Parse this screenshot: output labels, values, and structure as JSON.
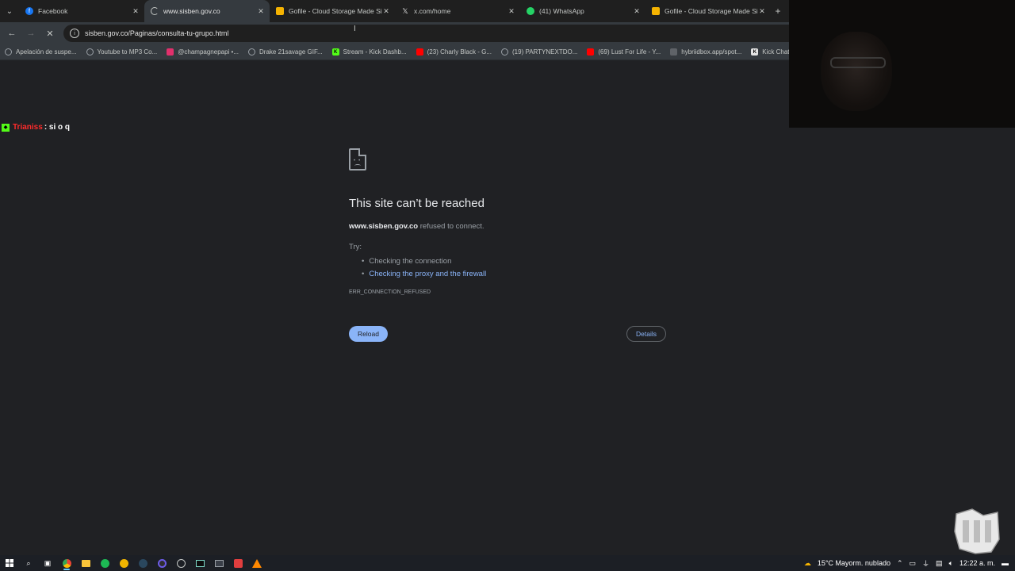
{
  "tabs": [
    {
      "title": "Facebook",
      "icon": "facebook-icon",
      "color": "#1877f2",
      "active": false
    },
    {
      "title": "www.sisben.gov.co",
      "icon": "loading-spinner-icon",
      "color": "#c4c7c5",
      "active": true
    },
    {
      "title": "Gofile - Cloud Storage Made Si",
      "icon": "gofile-icon",
      "color": "#f5b301",
      "active": false
    },
    {
      "title": "x.com/home",
      "icon": "x-icon",
      "color": "#e3e3e3",
      "active": false
    },
    {
      "title": "(41) WhatsApp",
      "icon": "whatsapp-icon",
      "color": "#25d366",
      "active": false
    },
    {
      "title": "Gofile - Cloud Storage Made Si",
      "icon": "gofile-icon",
      "color": "#f5b301",
      "active": false
    }
  ],
  "toolbar": {
    "url": "sisben.gov.co/Paginas/consulta-tu-grupo.html"
  },
  "bookmarks": [
    {
      "label": "Apelación de suspe...",
      "icon": "globe-icon",
      "color": "#9aa0a6"
    },
    {
      "label": "Youtube to MP3 Co...",
      "icon": "globe-icon",
      "color": "#9aa0a6"
    },
    {
      "label": "@champagnepapi •...",
      "icon": "instagram-icon",
      "color": "#e1306c"
    },
    {
      "label": "Drake 21savage GIF...",
      "icon": "globe-icon",
      "color": "#9aa0a6"
    },
    {
      "label": "Stream - Kick Dashb...",
      "icon": "kick-icon",
      "color": "#53fc18"
    },
    {
      "label": "(23) Charly Black - G...",
      "icon": "youtube-icon",
      "color": "#ff0000"
    },
    {
      "label": "(19) PARTYNEXTDO...",
      "icon": "globe-icon",
      "color": "#9aa0a6"
    },
    {
      "label": "(69) Lust For Life - Y...",
      "icon": "youtube-icon",
      "color": "#ff0000"
    },
    {
      "label": "hybriidbox.app/spot...",
      "icon": "hb-icon",
      "color": "#9aa0a6"
    },
    {
      "label": "Kick Chat Ove",
      "icon": "kick-icon",
      "color": "#e3e3e3"
    }
  ],
  "chat": {
    "user": "Trianiss",
    "message": ": si o q"
  },
  "error": {
    "title": "This site can’t be reached",
    "host": "www.sisben.gov.co",
    "desc_suffix": " refused to connect.",
    "try_label": "Try:",
    "suggestion_1": "Checking the connection",
    "suggestion_2": "Checking the proxy and the firewall",
    "code": "ERR_CONNECTION_REFUSED",
    "reload_label": "Reload",
    "details_label": "Details"
  },
  "taskbar": {
    "weather": "15°C  Mayorm. nublado",
    "time": "12:22 a. m."
  }
}
